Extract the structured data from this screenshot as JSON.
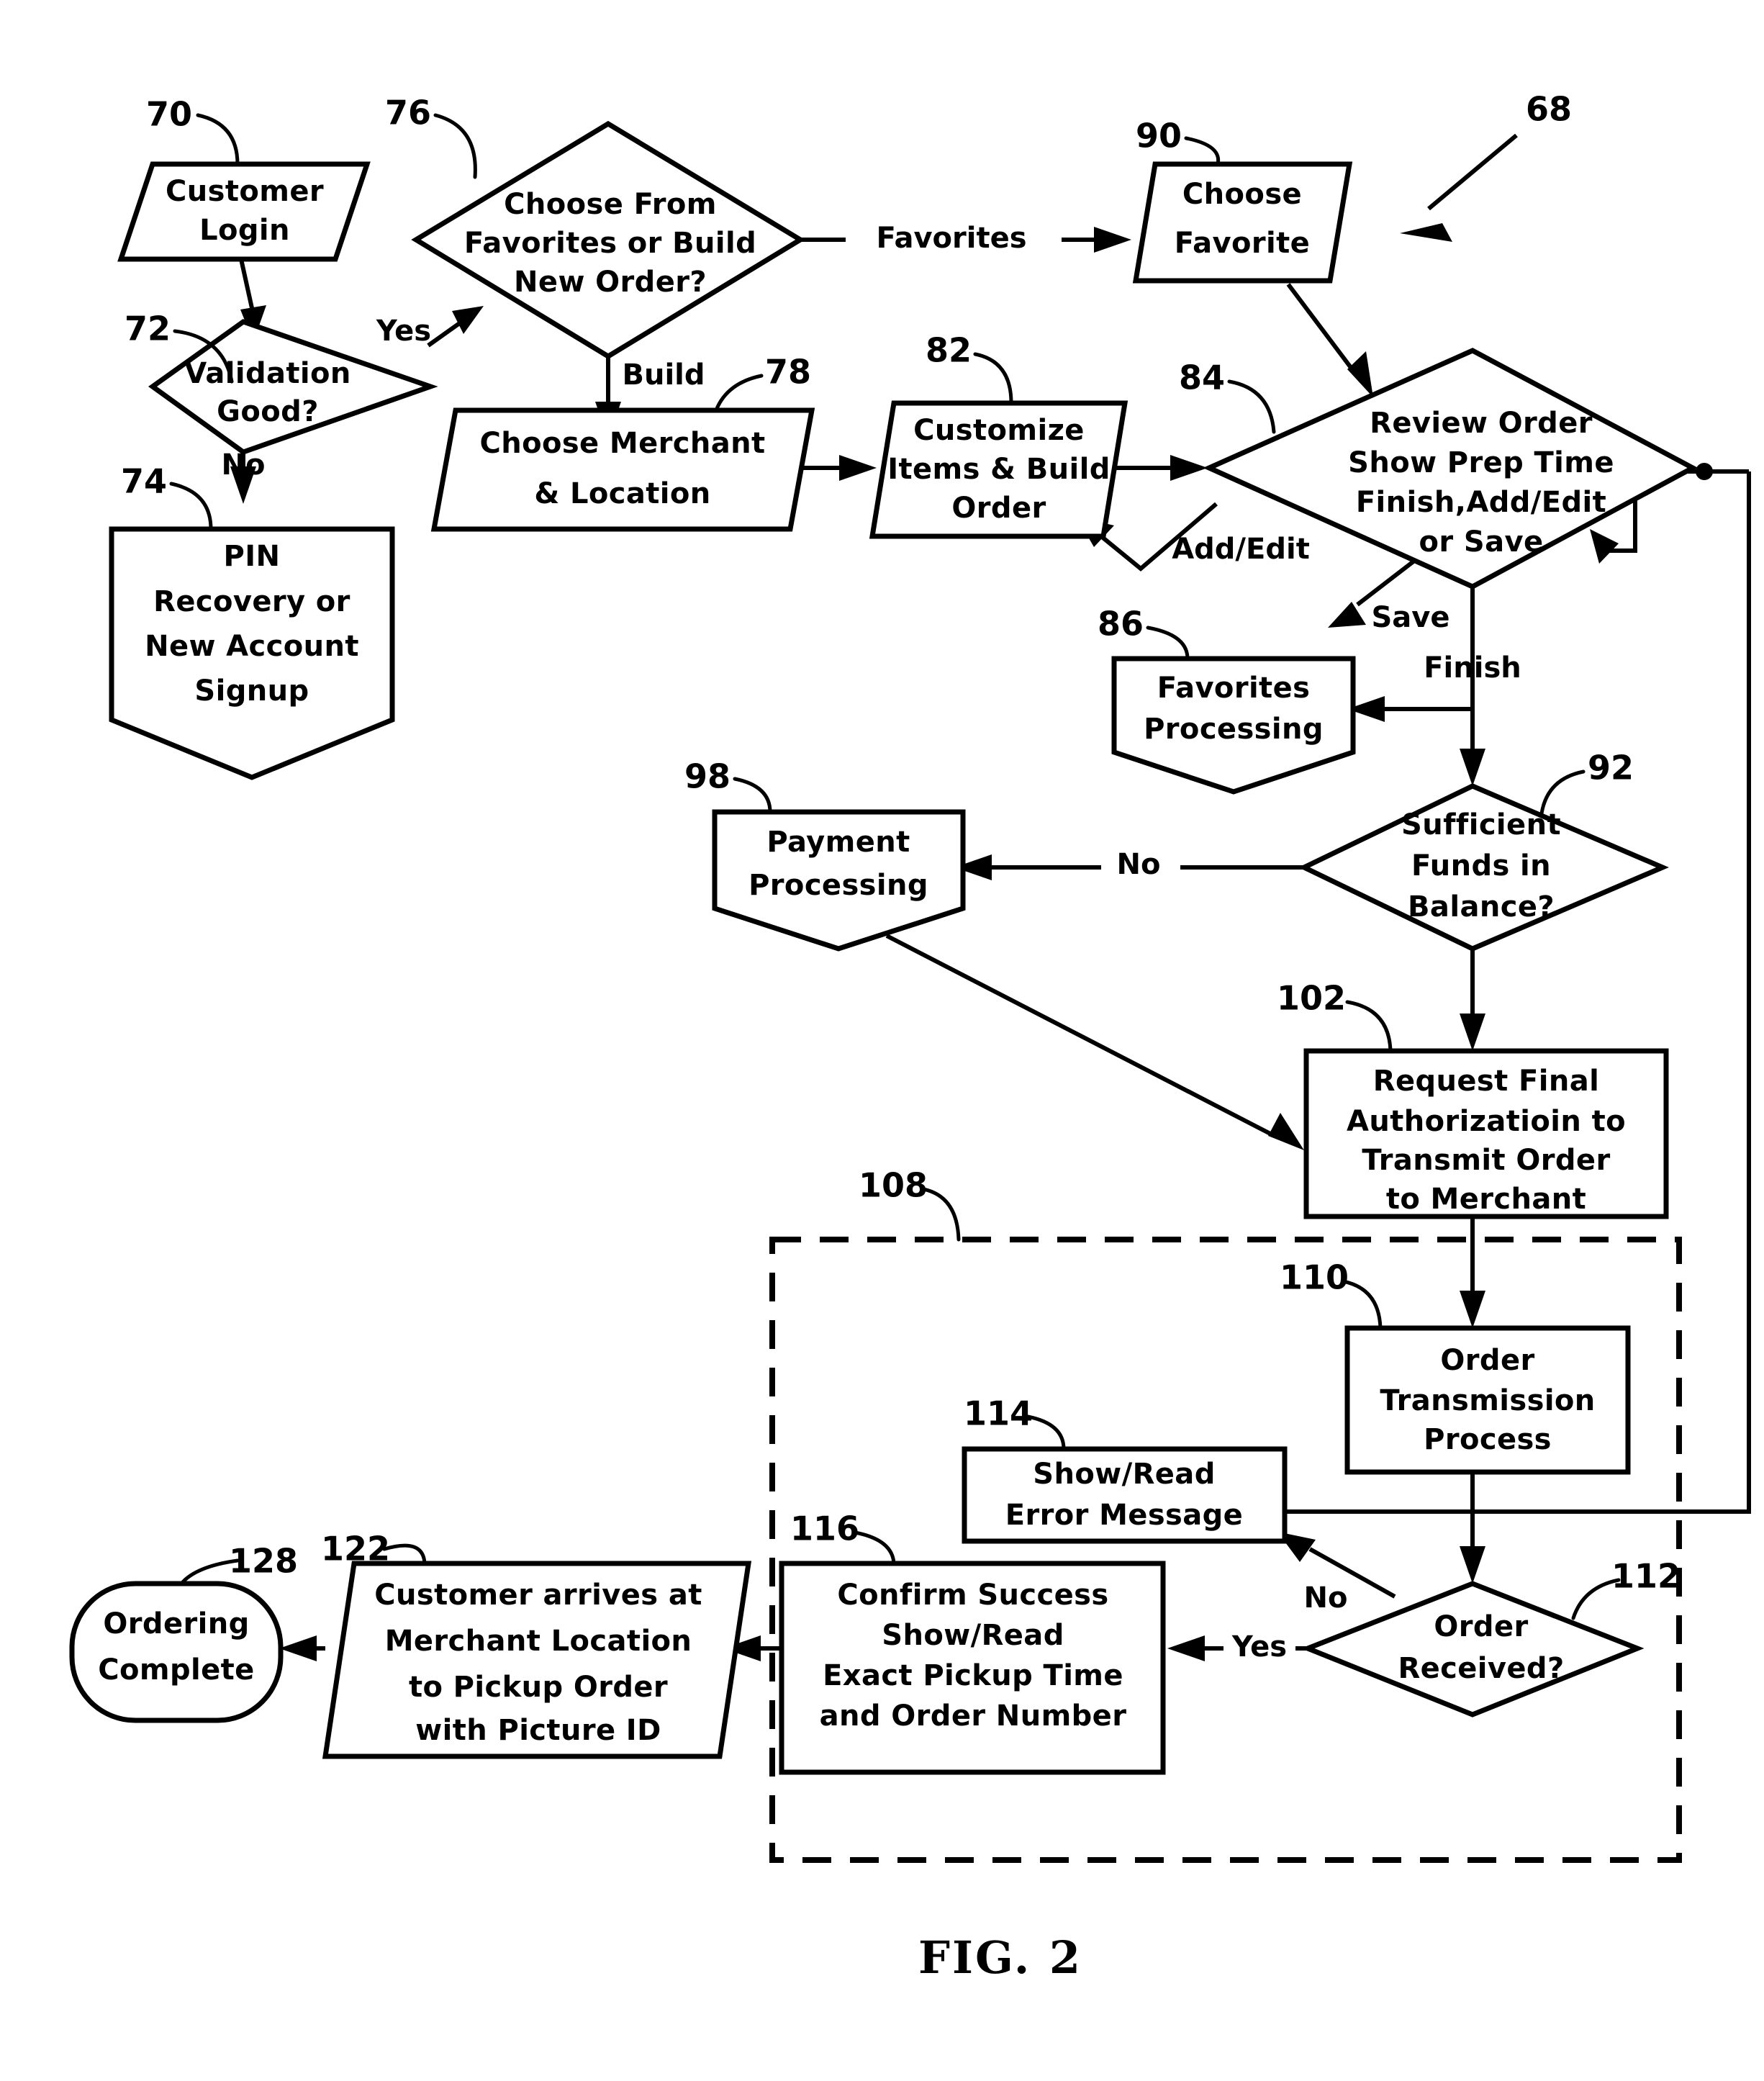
{
  "figure": {
    "caption": "FIG. 2",
    "overall_ref": "68"
  },
  "nodes": [
    {
      "id": "customer_login",
      "ref": "70",
      "shape": "parallelogram",
      "lines": [
        "Customer",
        "Login"
      ]
    },
    {
      "id": "validation_good",
      "ref": "72",
      "shape": "diamond",
      "lines": [
        "Validation",
        "Good?"
      ]
    },
    {
      "id": "pin_recovery",
      "ref": "74",
      "shape": "pentagon",
      "lines": [
        "PIN",
        "Recovery or",
        "New Account",
        "Signup"
      ]
    },
    {
      "id": "choose_from",
      "ref": "76",
      "shape": "diamond",
      "lines": [
        "Choose From",
        "Favorites or Build",
        "New Order?"
      ]
    },
    {
      "id": "choose_merchant",
      "ref": "78",
      "shape": "parallelogram",
      "lines": [
        "Choose Merchant",
        "& Location"
      ]
    },
    {
      "id": "customize_items",
      "ref": "82",
      "shape": "parallelogram",
      "lines": [
        "Customize",
        "Items & Build",
        "Order"
      ]
    },
    {
      "id": "review_order",
      "ref": "84",
      "shape": "diamond",
      "lines": [
        "Review Order",
        "Show Prep Time",
        "Finish,Add/Edit",
        "or Save"
      ]
    },
    {
      "id": "favorites_processing",
      "ref": "86",
      "shape": "pentagon",
      "lines": [
        "Favorites",
        "Processing"
      ]
    },
    {
      "id": "choose_favorite",
      "ref": "90",
      "shape": "parallelogram",
      "lines": [
        "Choose",
        "Favorite"
      ]
    },
    {
      "id": "sufficient_funds",
      "ref": "92",
      "shape": "diamond",
      "lines": [
        "Sufficient",
        "Funds in",
        "Balance?"
      ]
    },
    {
      "id": "payment_processing",
      "ref": "98",
      "shape": "pentagon",
      "lines": [
        "Payment",
        "Processing"
      ]
    },
    {
      "id": "request_final_auth",
      "ref": "102",
      "shape": "rect",
      "lines": [
        "Request Final",
        "Authorizatioin to",
        "Transmit Order",
        "to Merchant"
      ]
    },
    {
      "id": "merchant_zone",
      "ref": "108",
      "shape": "dashed-region",
      "lines": []
    },
    {
      "id": "order_transmission",
      "ref": "110",
      "shape": "rect",
      "lines": [
        "Order",
        "Transmission",
        "Process"
      ]
    },
    {
      "id": "order_received",
      "ref": "112",
      "shape": "diamond",
      "lines": [
        "Order",
        "Received?"
      ]
    },
    {
      "id": "show_error",
      "ref": "114",
      "shape": "rect",
      "lines": [
        "Show/Read",
        "Error Message"
      ]
    },
    {
      "id": "confirm_success",
      "ref": "116",
      "shape": "rect",
      "lines": [
        "Confirm Success",
        "Show/Read",
        "Exact Pickup Time",
        "and Order Number"
      ]
    },
    {
      "id": "customer_arrives",
      "ref": "122",
      "shape": "parallelogram",
      "lines": [
        "Customer arrives at",
        "Merchant Location",
        "to Pickup Order",
        "with Picture ID"
      ]
    },
    {
      "id": "ordering_complete",
      "ref": "128",
      "shape": "rounded",
      "lines": [
        "Ordering",
        "Complete"
      ]
    }
  ],
  "edge_labels": {
    "validation_yes": "Yes",
    "validation_no": "No",
    "choose_favorites": "Favorites",
    "choose_build": "Build",
    "review_add_edit": "Add/Edit",
    "review_save": "Save",
    "review_finish": "Finish",
    "funds_no": "No",
    "received_no": "No",
    "received_yes": "Yes"
  },
  "refnums": {
    "n70": "70",
    "n72": "72",
    "n74": "74",
    "n76": "76",
    "n78": "78",
    "n82": "82",
    "n84": "84",
    "n86": "86",
    "n90": "90",
    "n92": "92",
    "n98": "98",
    "n102": "102",
    "n108": "108",
    "n110": "110",
    "n112": "112",
    "n114": "114",
    "n116": "116",
    "n122": "122",
    "n128": "128",
    "n68": "68"
  },
  "node_text": {
    "customer_login_l1": "Customer",
    "customer_login_l2": "Login",
    "validation_l1": "Validation",
    "validation_l2": "Good?",
    "pin_l1": "PIN",
    "pin_l2": "Recovery or",
    "pin_l3": "New Account",
    "pin_l4": "Signup",
    "choosefrom_l1": "Choose From",
    "choosefrom_l2": "Favorites or Build",
    "choosefrom_l3": "New Order?",
    "merchant_l1": "Choose Merchant",
    "merchant_l2": "& Location",
    "customize_l1": "Customize",
    "customize_l2": "Items & Build",
    "customize_l3": "Order",
    "review_l1": "Review Order",
    "review_l2": "Show Prep Time",
    "review_l3": "Finish,Add/Edit",
    "review_l4": "or Save",
    "favproc_l1": "Favorites",
    "favproc_l2": "Processing",
    "choosefav_l1": "Choose",
    "choosefav_l2": "Favorite",
    "funds_l1": "Sufficient",
    "funds_l2": "Funds in",
    "funds_l3": "Balance?",
    "payment_l1": "Payment",
    "payment_l2": "Processing",
    "auth_l1": "Request Final",
    "auth_l2": "Authorizatioin to",
    "auth_l3": "Transmit Order",
    "auth_l4": "to Merchant",
    "transmission_l1": "Order",
    "transmission_l2": "Transmission",
    "transmission_l3": "Process",
    "received_l1": "Order",
    "received_l2": "Received?",
    "error_l1": "Show/Read",
    "error_l2": "Error Message",
    "confirm_l1": "Confirm Success",
    "confirm_l2": "Show/Read",
    "confirm_l3": "Exact Pickup Time",
    "confirm_l4": "and Order Number",
    "arrives_l1": "Customer arrives at",
    "arrives_l2": "Merchant Location",
    "arrives_l3": "to Pickup Order",
    "arrives_l4": "with Picture ID",
    "complete_l1": "Ordering",
    "complete_l2": "Complete"
  },
  "colors": {
    "ink": "#000000",
    "paper": "#ffffff"
  }
}
